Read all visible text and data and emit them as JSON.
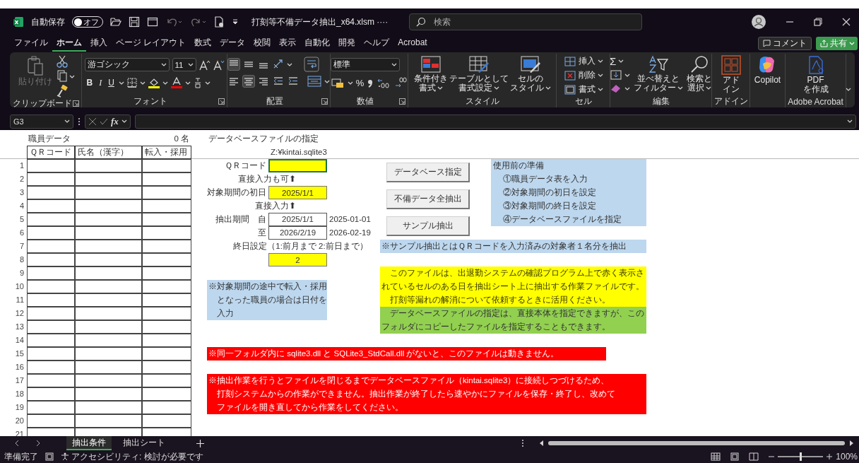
{
  "title_bar": {
    "autosave_label": "自動保存",
    "autosave": {
      "on": false,
      "state": "オフ"
    },
    "file_name": "打刻等不備データ抽出_x64.xlsm ····",
    "search_placeholder": "検索"
  },
  "menu_tabs": [
    {
      "label": "ファイル",
      "selected": false
    },
    {
      "label": "ホーム",
      "selected": true
    },
    {
      "label": "挿入",
      "selected": false
    },
    {
      "label": "ページ レイアウト",
      "selected": false
    },
    {
      "label": "数式",
      "selected": false
    },
    {
      "label": "データ",
      "selected": false
    },
    {
      "label": "校閲",
      "selected": false
    },
    {
      "label": "表示",
      "selected": false
    },
    {
      "label": "自動化",
      "selected": false
    },
    {
      "label": "開発",
      "selected": false
    },
    {
      "label": "ヘルプ",
      "selected": false
    },
    {
      "label": "Acrobat",
      "selected": false
    }
  ],
  "comment_button": "コメント",
  "share_button": "共有",
  "ribbon": [
    {
      "kind": "clipboard",
      "label": "クリップボード",
      "paste": "貼り付け"
    },
    {
      "kind": "font",
      "label": "フォント",
      "font_name": "游ゴシック",
      "font_size": "11",
      "bold": "B",
      "italic": "I",
      "underline": "U"
    },
    {
      "kind": "alignment",
      "label": "配置",
      "vertical": [
        {
          "kind": "top",
          "selected": true
        },
        {
          "kind": "middle",
          "selected": false
        },
        {
          "kind": "bottom",
          "selected": false
        }
      ],
      "horizontal": [
        {
          "kind": "left",
          "selected": false
        },
        {
          "kind": "center",
          "selected": true
        },
        {
          "kind": "right",
          "selected": false
        }
      ]
    },
    {
      "kind": "number",
      "label": "数値",
      "format": "標準",
      "percent": "%"
    },
    {
      "kind": "styles",
      "label": "スタイル",
      "buttons": [
        [
          "条件付き",
          "書式"
        ],
        [
          "テーブルとして",
          "書式設定"
        ],
        [
          "セルの",
          "スタイル"
        ]
      ]
    },
    {
      "kind": "cells",
      "label": "セル",
      "buttons": [
        "挿入",
        "削除",
        "書式"
      ]
    },
    {
      "kind": "editing",
      "label": "編集",
      "sigma": "Σ",
      "buttons": [
        [
          "並べ替えと",
          "フィルター"
        ],
        [
          "検索と",
          "選択"
        ]
      ]
    },
    {
      "kind": "addin",
      "label": "アドイン",
      "button": [
        "アド",
        "イン"
      ]
    },
    {
      "kind": "copilot",
      "button": [
        "Copilot"
      ]
    },
    {
      "kind": "acrobat",
      "label": "Adobe Acrobat",
      "button": [
        "PDF",
        "を作成"
      ]
    }
  ],
  "formula_bar": {
    "name_box": "G3",
    "fx": "fx"
  },
  "sheet": {
    "staff_title": "職員データ",
    "staff_count": "0 名",
    "db_title": "データベースファイルの指定",
    "db_path": "Z:¥kintai.sqlite3",
    "columns": [
      "ＱＲコード",
      "氏名（漢字）",
      "転入・採用"
    ],
    "row_numbers": [
      "1",
      "2",
      "3",
      "4",
      "5",
      "6",
      "7",
      "8",
      "9",
      "10",
      "11",
      "12",
      "13",
      "14",
      "15",
      "16",
      "17",
      "18",
      "19",
      "20",
      "21"
    ],
    "qr_label": "ＱＲコード",
    "qr_selected": true,
    "qr_hint": "直接入力も可⬆",
    "start_label": "対象期間の初日",
    "start_value": "2025/1/1",
    "start_hint": "直接入力⬆",
    "period_label": "抽出期間　自",
    "period_from": "2025/1/1",
    "period_from_iso": "2025-01-01",
    "period_to_label": "至",
    "period_to": "2026/2/19",
    "period_to_iso": "2026-02-19",
    "end_setting_label": "終日設定（1:前月まで 2:前日まで）",
    "end_setting_value": "2",
    "buttons": [
      "データベース指定",
      "不備データ全抽出",
      "サンプル抽出"
    ],
    "prep_note": {
      "title": "使用前の準備",
      "steps": [
        "①職員データ表を入力",
        "②対象期間の初日を設定",
        "③対象期間の終日を設定",
        "④データベースファイルを指定"
      ]
    },
    "sample_note": "※サンプル抽出とはＱＲコードを入力済みの対象者１名分を抽出",
    "info_yellow": [
      "　このファイルは、出退勤システムの確認プログラム上で赤く表示さ",
      "れているセルのある日を抽出シート上に抽出する作業ファイルです。",
      "　打刻等漏れの解消について依頼するときに活用ください。"
    ],
    "info_green": [
      "　データベースファイルの指定は、直接本体を指定できますが、この",
      "フォルダにコピーしたファイルを指定することもできます。"
    ],
    "transfer_note": [
      "※対象期間の途中で転入・採用",
      "　となった職員の場合は日付を",
      "　入力"
    ],
    "warning_dll": "※同一フォルダ内に sqlite3.dll と SQLite3_StdCall.dll がないと、このファイルは動きません。",
    "warning_lock": [
      "※抽出作業を行うとファイルを閉じるまでデータベースファイル（kintai.sqlite3）に接続しつづけるため、",
      "　打刻システムからの作業ができません。抽出作業が終了したら速やかにファイルを保存・終了し、改めて",
      "　ファイルを開き直してから作業をしてください。"
    ]
  },
  "sheet_tabs": [
    {
      "label": "抽出条件",
      "selected": true
    },
    {
      "label": "抽出シート",
      "selected": false
    }
  ],
  "status_bar": {
    "ready": "準備完了",
    "accessibility": "アクセシビリティ: 検討が必要です",
    "zoom": {
      "level": 0.5,
      "reading": "100%"
    }
  }
}
